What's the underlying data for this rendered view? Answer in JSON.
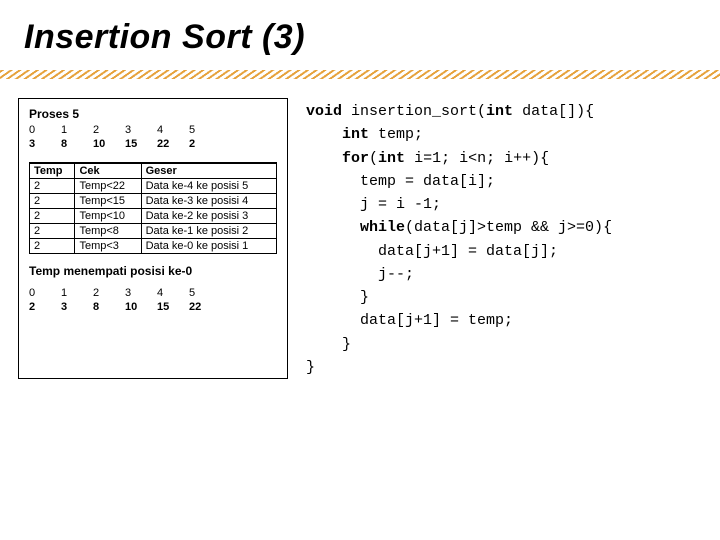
{
  "title": "Insertion Sort (3)",
  "left": {
    "proses_label": "Proses 5",
    "array_before": {
      "indices": [
        "0",
        "1",
        "2",
        "3",
        "4",
        "5"
      ],
      "values": [
        "3",
        "8",
        "10",
        "15",
        "22",
        "2"
      ],
      "highlight_index": 5
    },
    "steps_headers": [
      "Temp",
      "Cek",
      "Geser"
    ],
    "steps": [
      [
        "2",
        "Temp<22",
        "Data ke-4 ke posisi 5"
      ],
      [
        "2",
        "Temp<15",
        "Data ke-3 ke posisi 4"
      ],
      [
        "2",
        "Temp<10",
        "Data ke-2 ke posisi 3"
      ],
      [
        "2",
        "Temp<8",
        "Data ke-1 ke posisi 2"
      ],
      [
        "2",
        "Temp<3",
        "Data ke-0 ke posisi 1"
      ]
    ],
    "temp_line": "Temp menempati posisi ke-0",
    "array_after": {
      "indices": [
        "0",
        "1",
        "2",
        "3",
        "4",
        "5"
      ],
      "values": [
        "2",
        "3",
        "8",
        "10",
        "15",
        "22"
      ],
      "highlight_index": 0
    }
  },
  "code": {
    "l0a": "void",
    "l0b": " insertion_sort(",
    "l0c": "int",
    "l0d": " data[]){",
    "l1a": "int",
    "l1b": " temp;",
    "l2a": "for",
    "l2b": "(",
    "l2c": "int",
    "l2d": " i=1; i<n; i++){",
    "l3": "temp = data[i];",
    "l4": "j = i -1;",
    "l5a": "while",
    "l5b": "(data[j]>temp && j>=0){",
    "l6": "data[j+1] = data[j];",
    "l7": "j--;",
    "l8": "}",
    "l9": "data[j+1] = temp;",
    "l10": "}",
    "l11": "}"
  }
}
